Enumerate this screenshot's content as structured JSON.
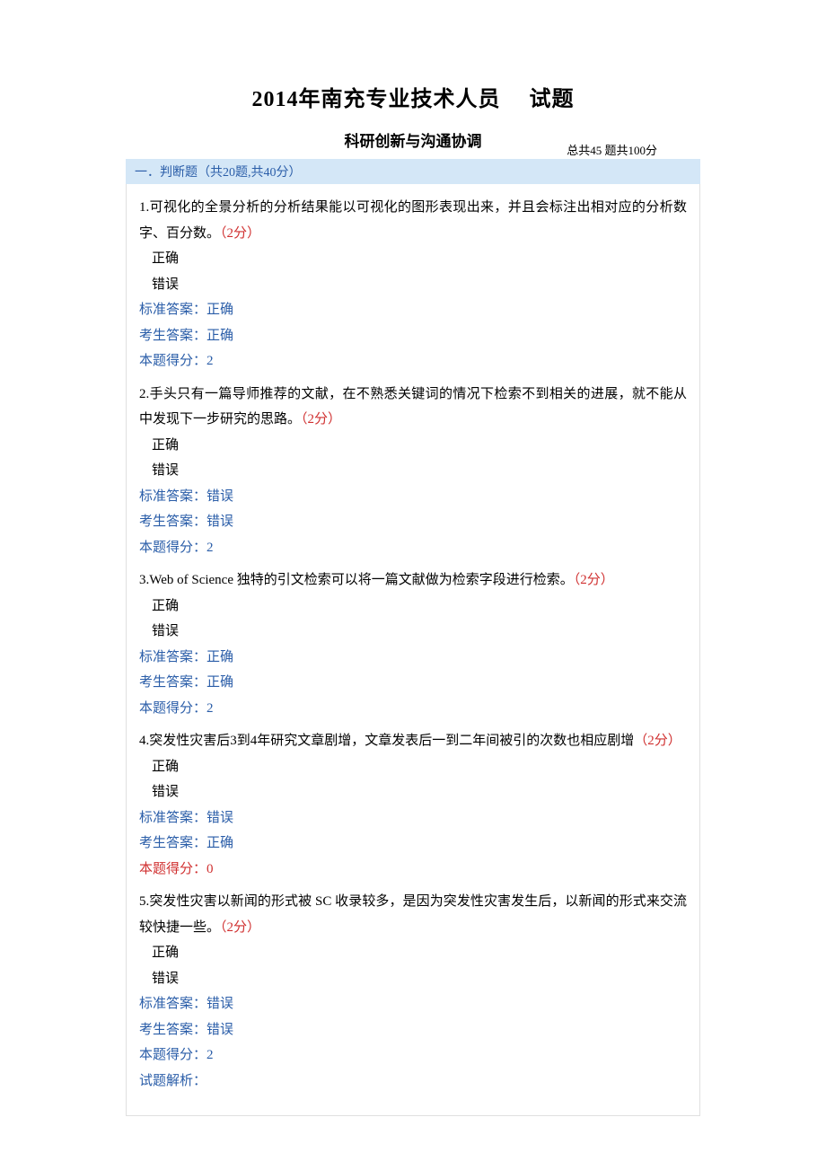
{
  "title_part1": "2014年南充专业技术人员",
  "title_part2": "试题",
  "subtitle": "科研创新与沟通协调",
  "meta": "总共45 题共100分",
  "section_header": "一．判断题（共20题,共40分）",
  "option_true": "正确",
  "option_false": "错误",
  "label_standard": "标准答案：",
  "label_candidate": "考生答案：",
  "label_score": "本题得分：",
  "label_analysis": "试题解析：",
  "questions": [
    {
      "num": "1.",
      "text": "可视化的全景分析的分析结果能以可视化的图形表现出来，并且会标注出相对应的分析数字、百分数。",
      "pts": "（2分）",
      "std": "正确",
      "cand": "正确",
      "score": "2",
      "score_color": "blue"
    },
    {
      "num": "2.",
      "text": "手头只有一篇导师推荐的文献，在不熟悉关键词的情况下检索不到相关的进展，就不能从中发现下一步研究的思路。",
      "pts": "（2分）",
      "std": "错误",
      "cand": "错误",
      "score": "2",
      "score_color": "blue"
    },
    {
      "num": "3.",
      "text": "Web of Science 独特的引文检索可以将一篇文献做为检索字段进行检索。",
      "pts": "（2分）",
      "std": "正确",
      "cand": "正确",
      "score": "2",
      "score_color": "blue"
    },
    {
      "num": "4.",
      "text": "突发性灾害后3到4年研究文章剧增，文章发表后一到二年间被引的次数也相应剧增",
      "pts": "（2分）",
      "std": "错误",
      "cand": "正确",
      "score": "0",
      "score_color": "red"
    },
    {
      "num": "5.",
      "text": "突发性灾害以新闻的形式被 SC 收录较多，是因为突发性灾害发生后，以新闻的形式来交流较快捷一些。",
      "pts": "（2分）",
      "std": "错误",
      "cand": "错误",
      "score": "2",
      "score_color": "blue",
      "show_analysis": true
    }
  ]
}
